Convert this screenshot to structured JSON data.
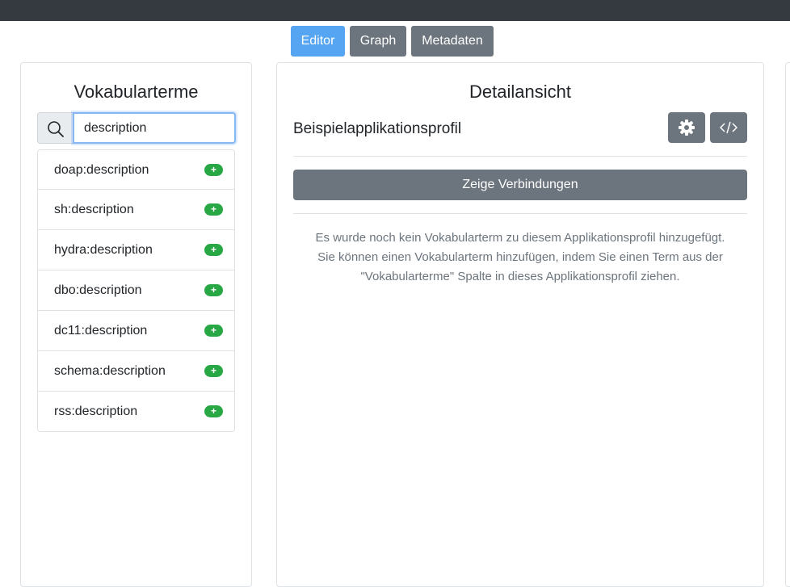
{
  "tabs": {
    "editor": "Editor",
    "graph": "Graph",
    "metadata": "Metadaten"
  },
  "colors": {
    "active_tab": "#55a5f2",
    "secondary": "#6c757d",
    "success": "#28a745",
    "topbar": "#343a40"
  },
  "left_panel": {
    "title": "Vokabularterme",
    "search": {
      "value": "description",
      "icon": "search-icon"
    },
    "terms": [
      {
        "label": "doap:description",
        "badge": "+"
      },
      {
        "label": "sh:description",
        "badge": "+"
      },
      {
        "label": "hydra:description",
        "badge": "+"
      },
      {
        "label": "dbo:description",
        "badge": "+"
      },
      {
        "label": "dc11:description",
        "badge": "+"
      },
      {
        "label": "schema:description",
        "badge": "+"
      },
      {
        "label": "rss:description",
        "badge": "+"
      }
    ]
  },
  "right_panel": {
    "title": "Detailansicht",
    "profile_name": "Beispielapplikationsprofil",
    "buttons": {
      "settings_icon": "gear-icon",
      "code_icon": "code-icon"
    },
    "show_connections": "Zeige Verbindungen",
    "empty_message": [
      "Es wurde noch kein Vokabularterm zu diesem Applikationsprofil hinzugefügt.",
      "Sie können einen Vokabularterm hinzufügen, indem Sie einen Term aus der",
      "\"Vokabularterme\" Spalte in dieses Applikationsprofil ziehen."
    ]
  }
}
